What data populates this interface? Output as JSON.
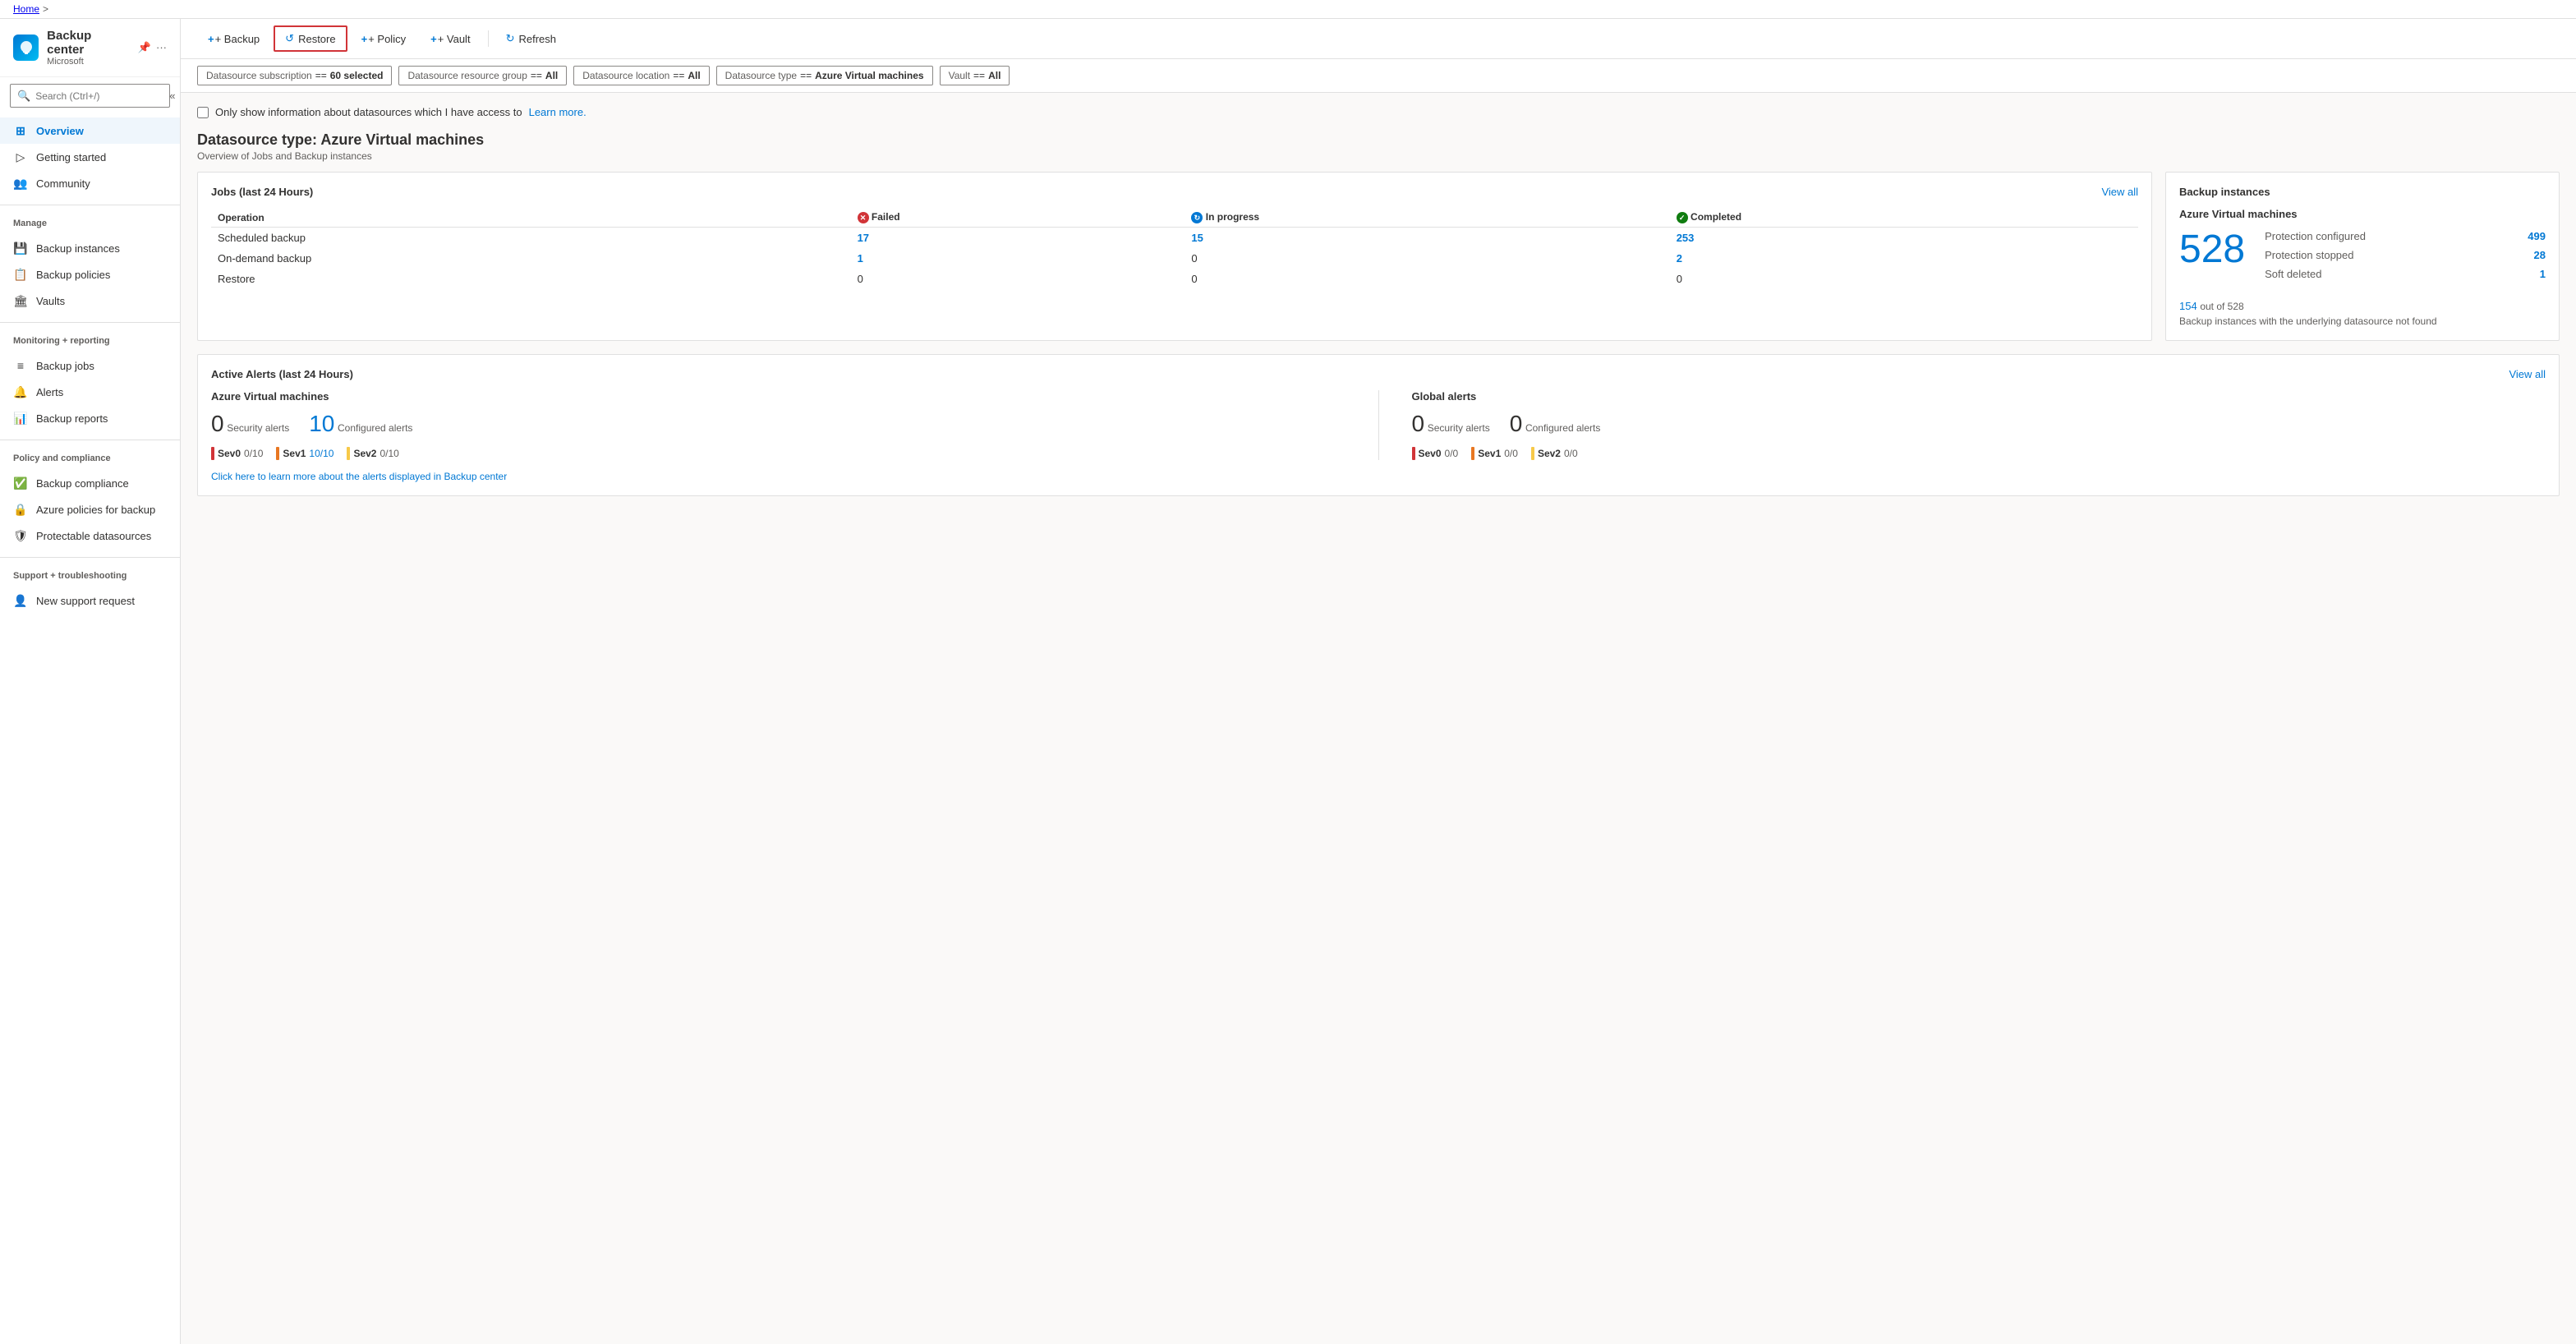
{
  "breadcrumb": {
    "home": "Home",
    "separator": ">"
  },
  "app": {
    "title": "Backup center",
    "subtitle": "Microsoft"
  },
  "search": {
    "placeholder": "Search (Ctrl+/)"
  },
  "toolbar": {
    "backup_label": "+ Backup",
    "restore_label": "Restore",
    "policy_label": "+ Policy",
    "vault_label": "+ Vault",
    "refresh_label": "Refresh"
  },
  "sidebar": {
    "nav_items": [
      {
        "id": "overview",
        "label": "Overview",
        "icon": "⊞",
        "active": true
      },
      {
        "id": "getting-started",
        "label": "Getting started",
        "icon": "▶"
      },
      {
        "id": "community",
        "label": "Community",
        "icon": "👥"
      }
    ],
    "manage_section": "Manage",
    "manage_items": [
      {
        "id": "backup-instances",
        "label": "Backup instances",
        "icon": "💾"
      },
      {
        "id": "backup-policies",
        "label": "Backup policies",
        "icon": "📋"
      },
      {
        "id": "vaults",
        "label": "Vaults",
        "icon": "🏛"
      }
    ],
    "monitoring_section": "Monitoring + reporting",
    "monitoring_items": [
      {
        "id": "backup-jobs",
        "label": "Backup jobs",
        "icon": "≡"
      },
      {
        "id": "alerts",
        "label": "Alerts",
        "icon": "🔔"
      },
      {
        "id": "backup-reports",
        "label": "Backup reports",
        "icon": "📊"
      }
    ],
    "policy_section": "Policy and compliance",
    "policy_items": [
      {
        "id": "backup-compliance",
        "label": "Backup compliance",
        "icon": "✅"
      },
      {
        "id": "azure-policies",
        "label": "Azure policies for backup",
        "icon": "🔒"
      },
      {
        "id": "protectable-datasources",
        "label": "Protectable datasources",
        "icon": "🛡"
      }
    ],
    "support_section": "Support + troubleshooting",
    "support_items": [
      {
        "id": "new-support",
        "label": "New support request",
        "icon": "👤"
      }
    ]
  },
  "filters": [
    {
      "key": "Datasource subscription",
      "op": "==",
      "val": "60 selected"
    },
    {
      "key": "Datasource resource group",
      "op": "==",
      "val": "All"
    },
    {
      "key": "Datasource location",
      "op": "==",
      "val": "All"
    },
    {
      "key": "Datasource type",
      "op": "==",
      "val": "Azure Virtual machines"
    },
    {
      "key": "Vault",
      "op": "==",
      "val": "All"
    }
  ],
  "checkbox_label": "Only show information about datasources which I have access to",
  "learn_more": "Learn more.",
  "page_title": "Datasource type: Azure Virtual machines",
  "page_subtitle": "Overview of Jobs and Backup instances",
  "jobs_card": {
    "title": "Jobs (last 24 Hours)",
    "view_all": "View all",
    "columns": [
      "Operation",
      "Failed",
      "In progress",
      "Completed"
    ],
    "rows": [
      {
        "op": "Scheduled backup",
        "failed": "17",
        "in_progress": "15",
        "completed": "253"
      },
      {
        "op": "On-demand backup",
        "failed": "1",
        "in_progress": "0",
        "completed": "2"
      },
      {
        "op": "Restore",
        "failed": "0",
        "in_progress": "0",
        "completed": "0"
      }
    ]
  },
  "backup_instances_card": {
    "title": "Backup instances",
    "vm_title": "Azure Virtual machines",
    "big_number": "528",
    "protection_configured_label": "Protection configured",
    "protection_configured_val": "499",
    "protection_stopped_label": "Protection stopped",
    "protection_stopped_val": "28",
    "soft_deleted_label": "Soft deleted",
    "soft_deleted_val": "1",
    "not_found_num": "154",
    "not_found_out_of": "out of 528",
    "not_found_text": "Backup instances with the underlying datasource not found"
  },
  "alerts_card": {
    "title": "Active Alerts (last 24 Hours)",
    "view_all": "View all",
    "azure_vm_section": {
      "title": "Azure Virtual machines",
      "security_count": "0",
      "security_label": "Security alerts",
      "configured_count": "10",
      "configured_label": "Configured alerts",
      "sev_items": [
        {
          "level": "Sev0",
          "color": "red",
          "val": "0/10"
        },
        {
          "level": "Sev1",
          "color": "orange",
          "val": "10/10",
          "blue": true
        },
        {
          "level": "Sev2",
          "color": "yellow",
          "val": "0/10"
        }
      ]
    },
    "global_section": {
      "title": "Global alerts",
      "security_count": "0",
      "security_label": "Security alerts",
      "configured_count": "0",
      "configured_label": "Configured alerts",
      "sev_items": [
        {
          "level": "Sev0",
          "color": "red",
          "val": "0/0"
        },
        {
          "level": "Sev1",
          "color": "orange",
          "val": "0/0"
        },
        {
          "level": "Sev2",
          "color": "yellow",
          "val": "0/0"
        }
      ]
    },
    "footer_link": "Click here to learn more about the alerts displayed in Backup center"
  }
}
